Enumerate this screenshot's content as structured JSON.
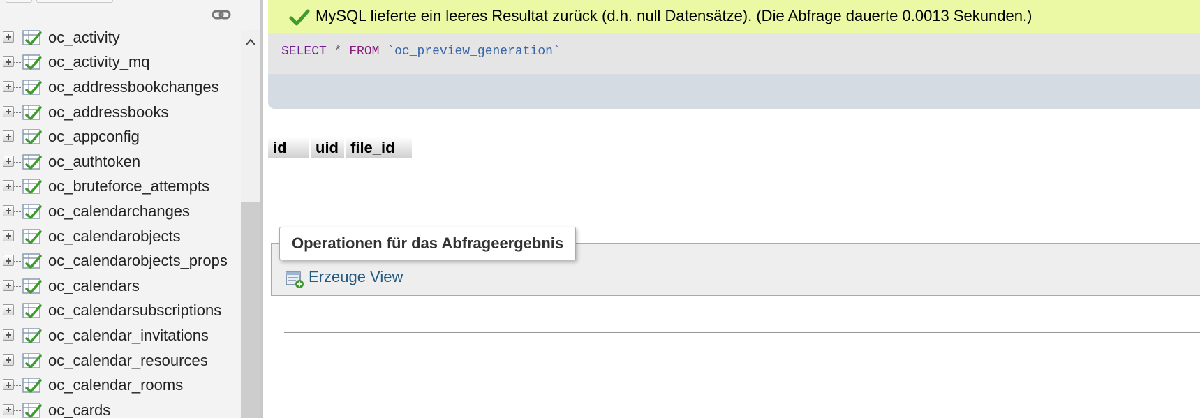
{
  "navigation": {
    "tables": [
      {
        "label": "oc_activity"
      },
      {
        "label": "oc_activity_mq"
      },
      {
        "label": "oc_addressbookchanges"
      },
      {
        "label": "oc_addressbooks"
      },
      {
        "label": "oc_appconfig"
      },
      {
        "label": "oc_authtoken"
      },
      {
        "label": "oc_bruteforce_attempts"
      },
      {
        "label": "oc_calendarchanges"
      },
      {
        "label": "oc_calendarobjects"
      },
      {
        "label": "oc_calendarobjects_props"
      },
      {
        "label": "oc_calendars"
      },
      {
        "label": "oc_calendarsubscriptions"
      },
      {
        "label": "oc_calendar_invitations"
      },
      {
        "label": "oc_calendar_resources"
      },
      {
        "label": "oc_calendar_rooms"
      },
      {
        "label": "oc_cards"
      }
    ]
  },
  "message": {
    "success_text": "MySQL lieferte ein leeres Resultat zurück (d.h. null Datensätze). (Die Abfrage dauerte 0.0013 Sekunden.)",
    "status_color": "#ebf8a4"
  },
  "query": {
    "select": "SELECT",
    "star": "*",
    "from": "FROM",
    "table": "`oc_preview_generation`"
  },
  "results": {
    "columns": [
      "id",
      "uid",
      "file_id"
    ]
  },
  "operations": {
    "legend": "Operationen für das Abfrageergebnis",
    "create_view_label": "Erzeuge View"
  },
  "colors": {
    "link": "#235a81",
    "keyword": "#6f1f91",
    "identifier": "#3866a8"
  }
}
